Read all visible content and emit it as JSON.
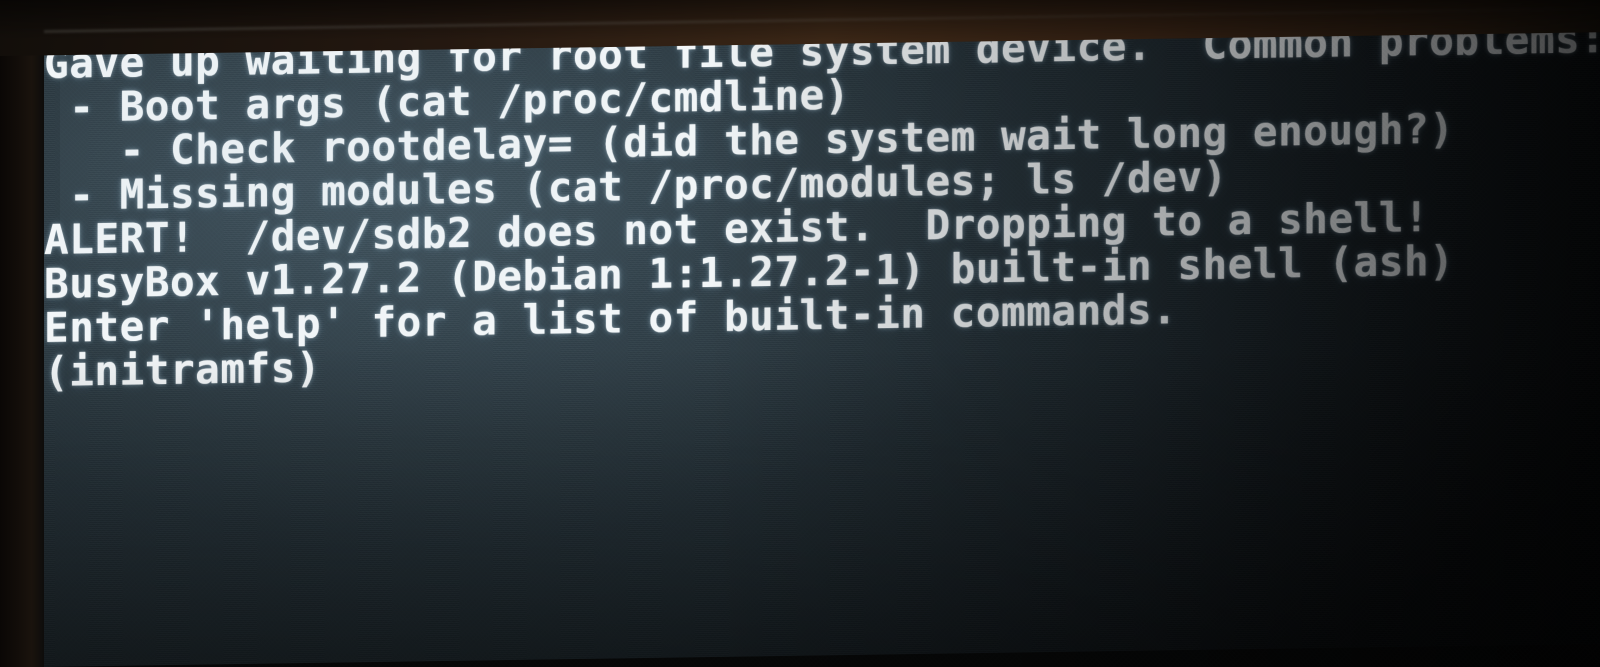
{
  "device": {
    "display_kind": "photographed-monitor",
    "screen_background_color": "#1c262b",
    "bezel_color": "#14100b",
    "text_color": "#f2f6f8"
  },
  "console": {
    "shell_name": "BusyBox",
    "shell_version": "v1.27.2",
    "distro_package": "Debian 1:1.27.2-1",
    "shell_variant": "ash",
    "missing_device": "/dev/sdb2",
    "prompt": "(initramfs)",
    "lines": [
      "Gave up waiting for root file system device.  Common problems:",
      " - Boot args (cat /proc/cmdline)",
      "   - Check rootdelay= (did the system wait long enough?)",
      " - Missing modules (cat /proc/modules; ls /dev)",
      "ALERT!  /dev/sdb2 does not exist.  Dropping to a shell!",
      "",
      "",
      "BusyBox v1.27.2 (Debian 1:1.27.2-1) built-in shell (ash)",
      "Enter 'help' for a list of built-in commands.",
      "",
      "(initramfs)"
    ]
  }
}
